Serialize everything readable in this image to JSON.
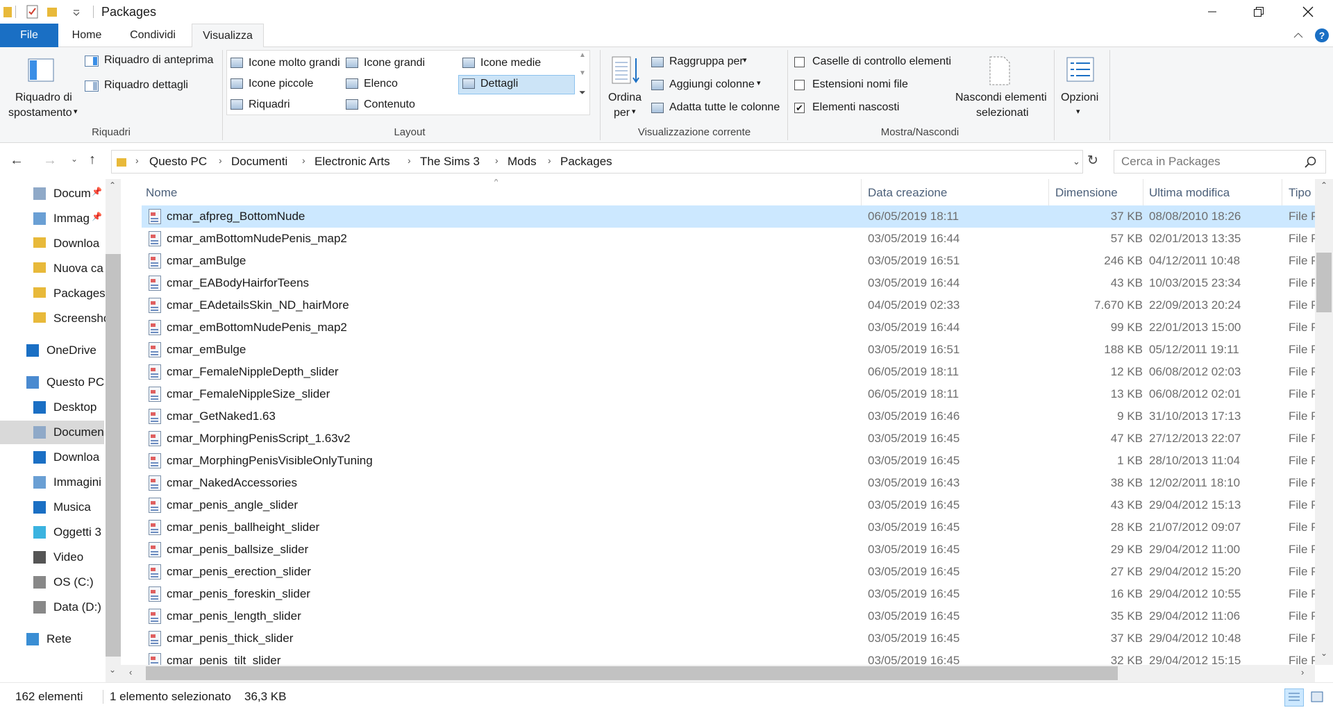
{
  "window": {
    "title": "Packages",
    "controls": {
      "minimize": "minimize-icon",
      "restore": "restore-icon",
      "close": "close-icon"
    }
  },
  "ribbon_tabs": [
    {
      "label": "File"
    },
    {
      "label": "Home"
    },
    {
      "label": "Condividi"
    },
    {
      "label": "Visualizza"
    }
  ],
  "ribbon": {
    "riquadri": {
      "nav_pane_line1": "Riquadro di",
      "nav_pane_line2": "spostamento",
      "preview": "Riquadro di anteprima",
      "details": "Riquadro dettagli",
      "group": "Riquadri"
    },
    "layout": {
      "options": [
        "Icone molto grandi",
        "Icone grandi",
        "Icone medie",
        "Icone piccole",
        "Elenco",
        "Dettagli",
        "Riquadri",
        "Contenuto"
      ],
      "selected": "Dettagli",
      "group": "Layout"
    },
    "current_view": {
      "sort_line1": "Ordina",
      "sort_line2": "per",
      "group_by": "Raggruppa per",
      "add_columns": "Aggiungi colonne",
      "fit_columns": "Adatta tutte le colonne",
      "group": "Visualizzazione corrente"
    },
    "show_hide": {
      "checkboxes": [
        {
          "label": "Caselle di controllo elementi",
          "checked": false
        },
        {
          "label": "Estensioni nomi file",
          "checked": false
        },
        {
          "label": "Elementi nascosti",
          "checked": true
        }
      ],
      "hide_selected_line1": "Nascondi elementi",
      "hide_selected_line2": "selezionati",
      "group": "Mostra/Nascondi"
    },
    "options": {
      "label": "Opzioni"
    }
  },
  "address": {
    "breadcrumbs": [
      "Questo PC",
      "Documenti",
      "Electronic Arts",
      "The Sims 3",
      "Mods",
      "Packages"
    ],
    "search_placeholder": "Cerca in Packages"
  },
  "nav_pane": [
    {
      "label": "Docum",
      "icon": "document-icon",
      "indent": 1,
      "pinned": true
    },
    {
      "label": "Immag",
      "icon": "image-icon",
      "indent": 1,
      "pinned": true
    },
    {
      "label": "Downloa",
      "icon": "folder-icon",
      "indent": 1
    },
    {
      "label": "Nuova ca",
      "icon": "folder-icon",
      "indent": 1
    },
    {
      "label": "Packages",
      "icon": "folder-icon",
      "indent": 1
    },
    {
      "label": "Screensho",
      "icon": "folder-icon",
      "indent": 1
    },
    {
      "label": "OneDrive",
      "icon": "cloud-icon",
      "indent": 0,
      "gap": true
    },
    {
      "label": "Questo PC",
      "icon": "computer-icon",
      "indent": 0,
      "gap": true
    },
    {
      "label": "Desktop",
      "icon": "desktop-icon",
      "indent": 1
    },
    {
      "label": "Documen",
      "icon": "document-icon",
      "indent": 1,
      "selected": true
    },
    {
      "label": "Downloa",
      "icon": "download-icon",
      "indent": 1
    },
    {
      "label": "Immagini",
      "icon": "image-icon",
      "indent": 1
    },
    {
      "label": "Musica",
      "icon": "music-icon",
      "indent": 1
    },
    {
      "label": "Oggetti 3",
      "icon": "cube-icon",
      "indent": 1
    },
    {
      "label": "Video",
      "icon": "video-icon",
      "indent": 1
    },
    {
      "label": "OS (C:)",
      "icon": "drive-icon",
      "indent": 1
    },
    {
      "label": "Data (D:)",
      "icon": "drive-icon",
      "indent": 1
    },
    {
      "label": "Rete",
      "icon": "network-icon",
      "indent": 0,
      "gap": true
    }
  ],
  "columns": [
    "Nome",
    "Data creazione",
    "Dimensione",
    "Ultima modifica",
    "Tipo"
  ],
  "files": [
    {
      "name": "cmar_afpreg_BottomNude",
      "created": "06/05/2019 18:11",
      "size": "37 KB",
      "modified": "08/08/2010 18:26",
      "type": "File P",
      "selected": true
    },
    {
      "name": "cmar_amBottomNudePenis_map2",
      "created": "03/05/2019 16:44",
      "size": "57 KB",
      "modified": "02/01/2013 13:35",
      "type": "File P"
    },
    {
      "name": "cmar_amBulge",
      "created": "03/05/2019 16:51",
      "size": "246 KB",
      "modified": "04/12/2011 10:48",
      "type": "File P"
    },
    {
      "name": "cmar_EABodyHairforTeens",
      "created": "03/05/2019 16:44",
      "size": "43 KB",
      "modified": "10/03/2015 23:34",
      "type": "File P"
    },
    {
      "name": "cmar_EAdetailsSkin_ND_hairMore",
      "created": "04/05/2019 02:33",
      "size": "7.670 KB",
      "modified": "22/09/2013 20:24",
      "type": "File P"
    },
    {
      "name": "cmar_emBottomNudePenis_map2",
      "created": "03/05/2019 16:44",
      "size": "99 KB",
      "modified": "22/01/2013 15:00",
      "type": "File P"
    },
    {
      "name": "cmar_emBulge",
      "created": "03/05/2019 16:51",
      "size": "188 KB",
      "modified": "05/12/2011 19:11",
      "type": "File P"
    },
    {
      "name": "cmar_FemaleNippleDepth_slider",
      "created": "06/05/2019 18:11",
      "size": "12 KB",
      "modified": "06/08/2012 02:03",
      "type": "File P"
    },
    {
      "name": "cmar_FemaleNippleSize_slider",
      "created": "06/05/2019 18:11",
      "size": "13 KB",
      "modified": "06/08/2012 02:01",
      "type": "File P"
    },
    {
      "name": "cmar_GetNaked1.63",
      "created": "03/05/2019 16:46",
      "size": "9 KB",
      "modified": "31/10/2013 17:13",
      "type": "File P"
    },
    {
      "name": "cmar_MorphingPenisScript_1.63v2",
      "created": "03/05/2019 16:45",
      "size": "47 KB",
      "modified": "27/12/2013 22:07",
      "type": "File P"
    },
    {
      "name": "cmar_MorphingPenisVisibleOnlyTuning",
      "created": "03/05/2019 16:45",
      "size": "1 KB",
      "modified": "28/10/2013 11:04",
      "type": "File P"
    },
    {
      "name": "cmar_NakedAccessories",
      "created": "03/05/2019 16:43",
      "size": "38 KB",
      "modified": "12/02/2011 18:10",
      "type": "File P"
    },
    {
      "name": "cmar_penis_angle_slider",
      "created": "03/05/2019 16:45",
      "size": "43 KB",
      "modified": "29/04/2012 15:13",
      "type": "File P"
    },
    {
      "name": "cmar_penis_ballheight_slider",
      "created": "03/05/2019 16:45",
      "size": "28 KB",
      "modified": "21/07/2012 09:07",
      "type": "File P"
    },
    {
      "name": "cmar_penis_ballsize_slider",
      "created": "03/05/2019 16:45",
      "size": "29 KB",
      "modified": "29/04/2012 11:00",
      "type": "File P"
    },
    {
      "name": "cmar_penis_erection_slider",
      "created": "03/05/2019 16:45",
      "size": "27 KB",
      "modified": "29/04/2012 15:20",
      "type": "File P"
    },
    {
      "name": "cmar_penis_foreskin_slider",
      "created": "03/05/2019 16:45",
      "size": "16 KB",
      "modified": "29/04/2012 10:55",
      "type": "File P"
    },
    {
      "name": "cmar_penis_length_slider",
      "created": "03/05/2019 16:45",
      "size": "35 KB",
      "modified": "29/04/2012 11:06",
      "type": "File P"
    },
    {
      "name": "cmar_penis_thick_slider",
      "created": "03/05/2019 16:45",
      "size": "37 KB",
      "modified": "29/04/2012 10:48",
      "type": "File P"
    },
    {
      "name": "cmar_penis_tilt_slider",
      "created": "03/05/2019 16:45",
      "size": "32 KB",
      "modified": "29/04/2012 15:15",
      "type": "File P"
    }
  ],
  "status": {
    "count": "162 elementi",
    "selection": "1 elemento selezionato",
    "selection_size": "36,3 KB"
  },
  "colors": {
    "accent": "#1a6fc4",
    "selection": "#cce8ff",
    "ribbon_bg": "#f5f6f7"
  }
}
